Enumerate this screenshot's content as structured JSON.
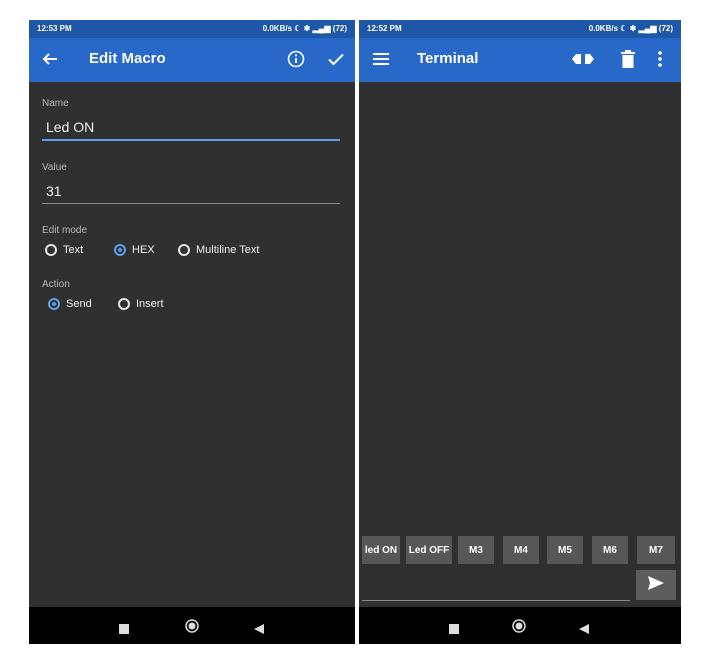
{
  "left_screen": {
    "status": {
      "time": "12:53 PM",
      "right": "0.0KB/s ☾ ✱ ▂▄▆ (72)"
    },
    "title": "Edit Macro",
    "name_label": "Name",
    "name_value": "Led ON",
    "value_label": "Value",
    "value_value": "31",
    "edit_mode_label": "Edit mode",
    "edit_modes": [
      "Text",
      "HEX",
      "Multiline Text"
    ],
    "edit_mode_selected": "HEX",
    "action_label": "Action",
    "actions": [
      "Send",
      "Insert"
    ],
    "action_selected": "Send"
  },
  "right_screen": {
    "status": {
      "time": "12:52 PM",
      "right": "0.0KB/s ☾ ✱ ▂▄▆ (72)"
    },
    "title": "Terminal",
    "macros": [
      "led ON",
      "Led OFF",
      "M3",
      "M4",
      "M5",
      "M6",
      "M7"
    ],
    "input_value": ""
  },
  "icons": {
    "back": "arrow-back-icon",
    "info": "info-icon",
    "confirm": "check-icon",
    "menu": "hamburger-menu-icon",
    "connect": "connection-icon",
    "delete": "trash-icon",
    "more": "more-vert-icon",
    "send": "send-icon",
    "nav_recents": "square-icon",
    "nav_home": "circle-icon",
    "nav_back": "triangle-back-icon"
  },
  "colors": {
    "appbar": "#2868c8",
    "statusbar": "#1e56a8",
    "accent": "#5aa0ea",
    "background": "#303030",
    "macro_button": "#575757"
  }
}
